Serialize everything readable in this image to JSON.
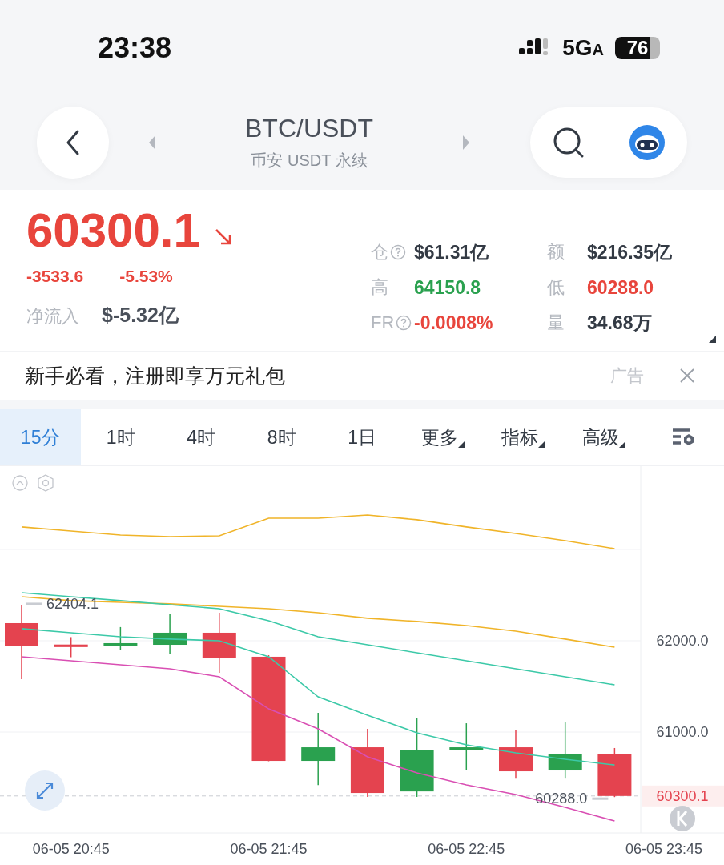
{
  "status_bar": {
    "time": "23:38",
    "network": "5G",
    "network_suffix": "A",
    "battery": "76"
  },
  "header": {
    "title": "BTC/USDT",
    "subtitle": "币安 USDT 永续"
  },
  "quote": {
    "price": "60300.1",
    "change": "-3533.6",
    "change_percent": "-5.53%",
    "net_inflow_label": "净流入",
    "net_inflow": "$-5.32亿"
  },
  "stats": [
    {
      "label": "仓",
      "help": true,
      "value": "$61.31亿",
      "color": "#333a44"
    },
    {
      "label": "额",
      "help": false,
      "value": "$216.35亿",
      "color": "#333a44"
    },
    {
      "label": "高",
      "help": false,
      "value": "64150.8",
      "color": "#2aa14f"
    },
    {
      "label": "低",
      "help": false,
      "value": "60288.0",
      "color": "#e8453c"
    },
    {
      "label": "FR",
      "help": true,
      "value": "-0.0008%",
      "color": "#e8453c"
    },
    {
      "label": "量",
      "help": false,
      "value": "34.68万",
      "color": "#333a44"
    }
  ],
  "ad": {
    "text": "新手必看，注册即享万元礼包",
    "tag": "广告"
  },
  "tabs": [
    {
      "label": "15分",
      "selected": true,
      "menu": false
    },
    {
      "label": "1时",
      "selected": false,
      "menu": false
    },
    {
      "label": "4时",
      "selected": false,
      "menu": false
    },
    {
      "label": "8时",
      "selected": false,
      "menu": false
    },
    {
      "label": "1日",
      "selected": false,
      "menu": false
    },
    {
      "label": "更多",
      "selected": false,
      "menu": true
    },
    {
      "label": "指标",
      "selected": false,
      "menu": true
    },
    {
      "label": "高级",
      "selected": false,
      "menu": true
    }
  ],
  "chart": {
    "price_labels": [
      "62000.0",
      "61000.0"
    ],
    "time_labels": [
      "06-05 20:45",
      "06-05 21:45",
      "06-05 22:45",
      "06-05 23:45"
    ],
    "high_label": "62404.1",
    "low_label": "60288.0",
    "last_price": "60300.1"
  }
}
